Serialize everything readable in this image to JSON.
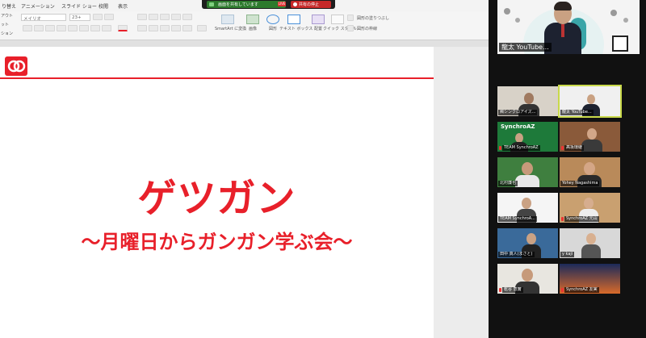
{
  "ribbon": {
    "tabs": [
      "り替え",
      "アニメーション",
      "スライド ショー",
      "校閲",
      "表示"
    ],
    "font_name": "メイリオ",
    "font_size": "23+",
    "side_labels": [
      "アウト",
      "ット",
      "ション"
    ],
    "buttons": [
      "SmartArt に変換",
      "画像",
      "図形",
      "テキスト ボックス",
      "配置",
      "クイック スタイル",
      "図形の塗りつぶし",
      "図形の枠線"
    ]
  },
  "zoom_bar": {
    "share_label": "画面を共有しています",
    "live_badge": "LIVE",
    "stop_label": "共有の停止"
  },
  "slide": {
    "title": "ゲツガン",
    "subtitle": "～月曜日からガンガン学ぶ会～"
  },
  "colors": {
    "accent_red": "#e8202a",
    "active_speaker_border": "#c9d94a"
  },
  "gallery": {
    "speaker_name": "龍太 YouTube...",
    "participants": [
      {
        "name": "㈱シンクロアイズ..."
      },
      {
        "name": "龍太 YouTube..."
      },
      {
        "name": "TEAM SynchroAZ"
      },
      {
        "name": "髙坂環継"
      },
      {
        "name": "北村廉也"
      },
      {
        "name": "Yohey Nagashima"
      },
      {
        "name": "TEAM SynchroA..."
      },
      {
        "name": "SynchroAZ 元山"
      },
      {
        "name": "田中 真人(まさと)"
      },
      {
        "name": "y kaji"
      },
      {
        "name": "乾谷 恵實"
      },
      {
        "name": "SynchroAZ 友実"
      }
    ],
    "banner_text": "SynchroAZ"
  }
}
